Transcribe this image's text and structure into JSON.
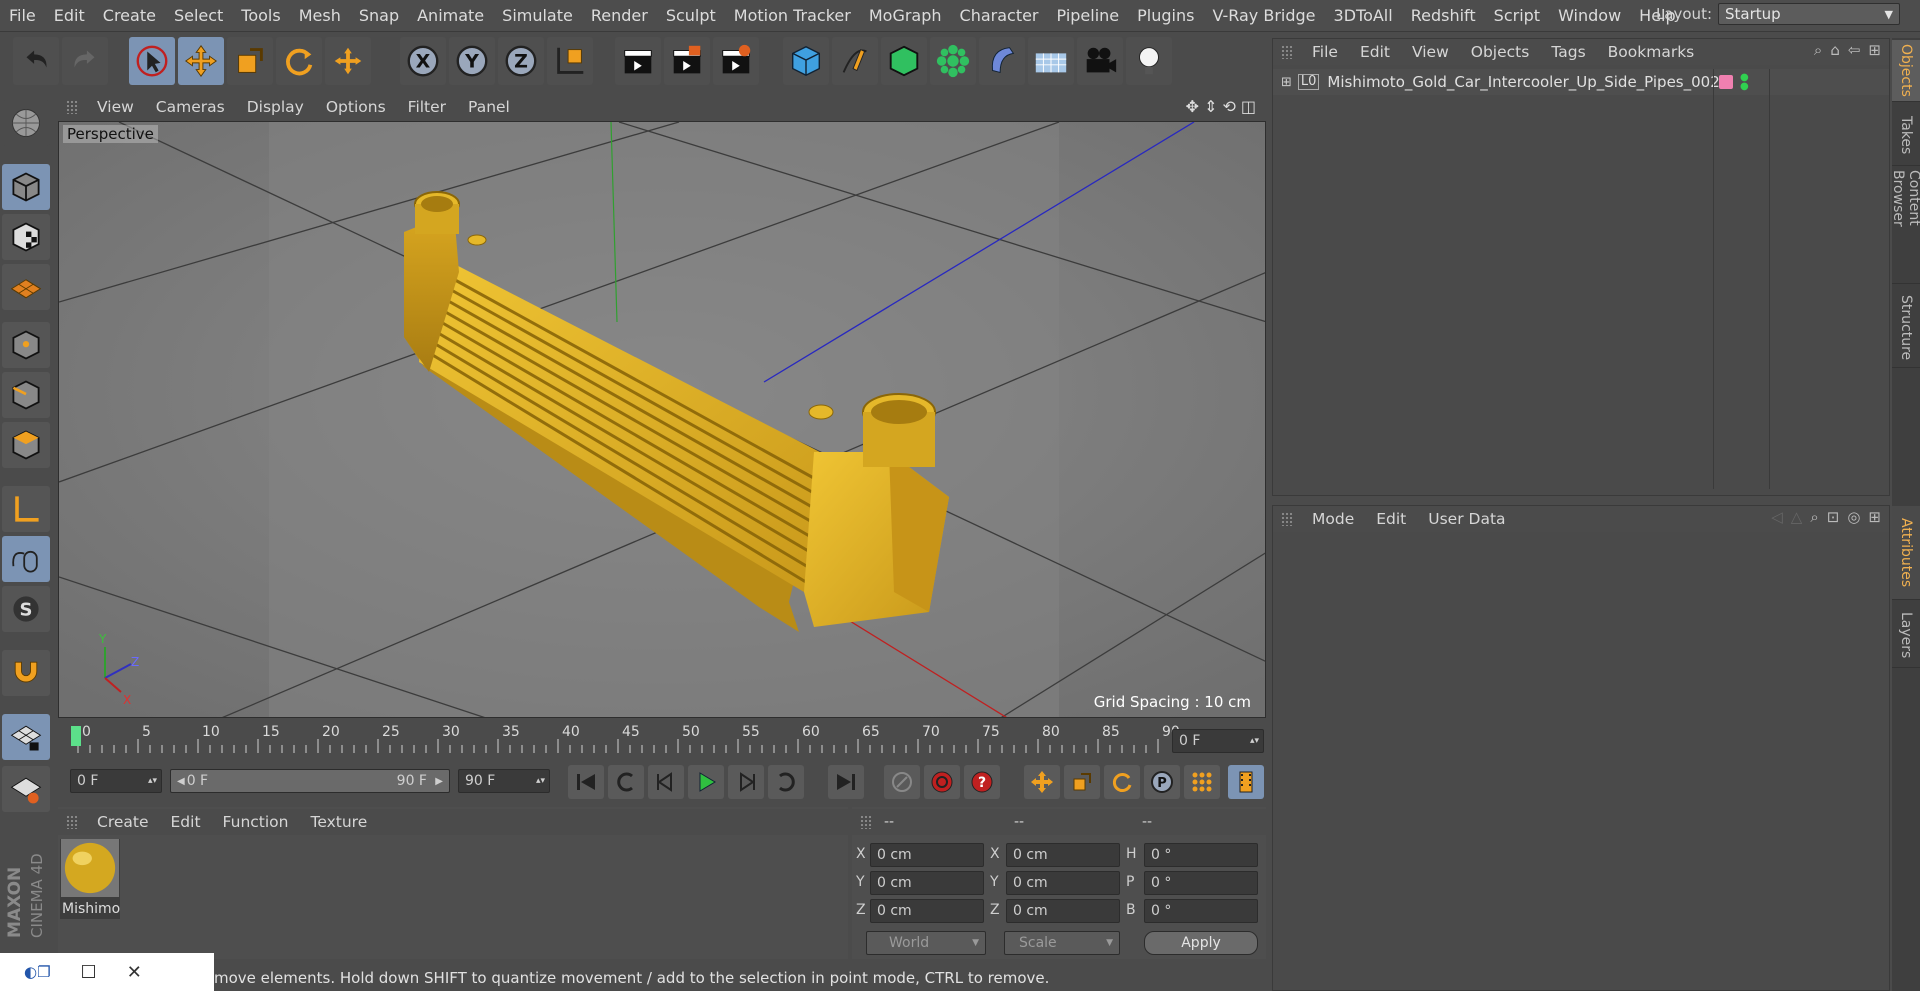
{
  "menubar": {
    "items": [
      "File",
      "Edit",
      "Create",
      "Select",
      "Tools",
      "Mesh",
      "Snap",
      "Animate",
      "Simulate",
      "Render",
      "Sculpt",
      "Motion Tracker",
      "MoGraph",
      "Character",
      "Pipeline",
      "Plugins",
      "V-Ray Bridge",
      "3DToAll",
      "Redshift",
      "Script",
      "Window",
      "Help"
    ],
    "layout_label": "Layout:",
    "layout_value": "Startup"
  },
  "viewport": {
    "menu": [
      "View",
      "Cameras",
      "Display",
      "Options",
      "Filter",
      "Panel"
    ],
    "label": "Perspective",
    "grid_spacing": "Grid Spacing : 10 cm",
    "axis": {
      "x": "X",
      "y": "Y",
      "z": "Z"
    }
  },
  "timeline": {
    "ticks": [
      "0",
      "5",
      "10",
      "15",
      "20",
      "25",
      "30",
      "35",
      "40",
      "45",
      "50",
      "55",
      "60",
      "65",
      "70",
      "75",
      "80",
      "85",
      "90"
    ],
    "current_frame": "0 F"
  },
  "transport": {
    "start_field": "0 F",
    "range_start": "0 F",
    "range_end": "90 F",
    "end_field": "90 F"
  },
  "material_panel": {
    "menu": [
      "Create",
      "Edit",
      "Function",
      "Texture"
    ],
    "material_name": "Mishimo"
  },
  "coord_panel": {
    "headers": [
      "--",
      "--",
      "--"
    ],
    "rows": [
      {
        "a": "X",
        "av": "0 cm",
        "b": "X",
        "bv": "0 cm",
        "c": "H",
        "cv": "0 °"
      },
      {
        "a": "Y",
        "av": "0 cm",
        "b": "Y",
        "bv": "0 cm",
        "c": "P",
        "cv": "0 °"
      },
      {
        "a": "Z",
        "av": "0 cm",
        "b": "Z",
        "bv": "0 cm",
        "c": "B",
        "cv": "0 °"
      }
    ],
    "world": "World",
    "scale": "Scale",
    "apply": "Apply"
  },
  "object_panel": {
    "menu": [
      "File",
      "Edit",
      "View",
      "Objects",
      "Tags",
      "Bookmarks"
    ],
    "object_name": "Mishimoto_Gold_Car_Intercooler_Up_Side_Pipes_002",
    "tag_color": "#f080b0"
  },
  "attr_panel": {
    "menu": [
      "Mode",
      "Edit",
      "User Data"
    ]
  },
  "right_tabs": [
    "Objects",
    "Takes",
    "Content Browser",
    "Structure",
    "Attributes",
    "Layers"
  ],
  "status": {
    "text": "move elements. Hold down SHIFT to quantize movement / add to the selection in point mode, CTRL to remove."
  },
  "brand": {
    "line1": "MAXON",
    "line2": "CINEMA 4D"
  },
  "colors": {
    "accent_blue": "#7c94b4",
    "model_yellow": "#e2b522",
    "highlight_orange": "#f0b050"
  }
}
